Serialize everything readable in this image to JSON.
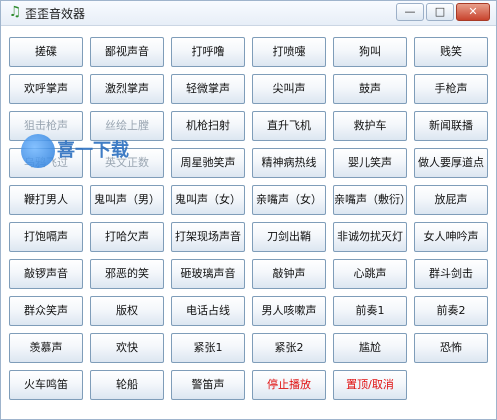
{
  "window": {
    "title": "歪歪音效器",
    "controls": {
      "minimize": "—",
      "maximize": "□",
      "close": "✕"
    }
  },
  "icons": {
    "app": "music-note-icon"
  },
  "buttons": [
    "搓碟",
    "鄙视声音",
    "打呼噜",
    "打喷嚏",
    "狗叫",
    "贱笑",
    "欢呼掌声",
    "激烈掌声",
    "轻微掌声",
    "尖叫声",
    "鼓声",
    "手枪声",
    "狙击枪声",
    "丝绘上膛",
    "机枪扫射",
    "直升飞机",
    "救护车",
    "新闻联播",
    "乌鸦飞过",
    "英文正数",
    "周星驰笑声",
    "精神病热线",
    "婴儿笑声",
    "做人要厚道点",
    "鞭打男人",
    "鬼叫声（男）",
    "鬼叫声（女）",
    "亲嘴声（女）",
    "亲嘴声（敷衍）",
    "放屁声",
    "打饱嗝声",
    "打哈欠声",
    "打架现场声音",
    "刀剑出鞘",
    "非诚勿扰灭灯",
    "女人呻吟声",
    "敲锣声音",
    "邪恶的笑",
    "砸玻璃声音",
    "敲钟声",
    "心跳声",
    "群斗剑击",
    "群众笑声",
    "版权",
    "电话占线",
    "男人咳嗽声",
    "前奏1",
    "前奏2",
    "羡慕声",
    "欢快",
    "紧张1",
    "紧张2",
    "尴尬",
    "恐怖",
    "火车鸣笛",
    "轮船",
    "警笛声",
    "停止播放",
    "置顶/取消"
  ],
  "red_buttons": [
    57,
    58
  ],
  "faded_buttons": [
    12,
    13,
    18,
    19
  ],
  "watermark": {
    "text": "喜一下载"
  },
  "colors": {
    "accent_red": "#e01010",
    "border": "#7f9db9"
  }
}
